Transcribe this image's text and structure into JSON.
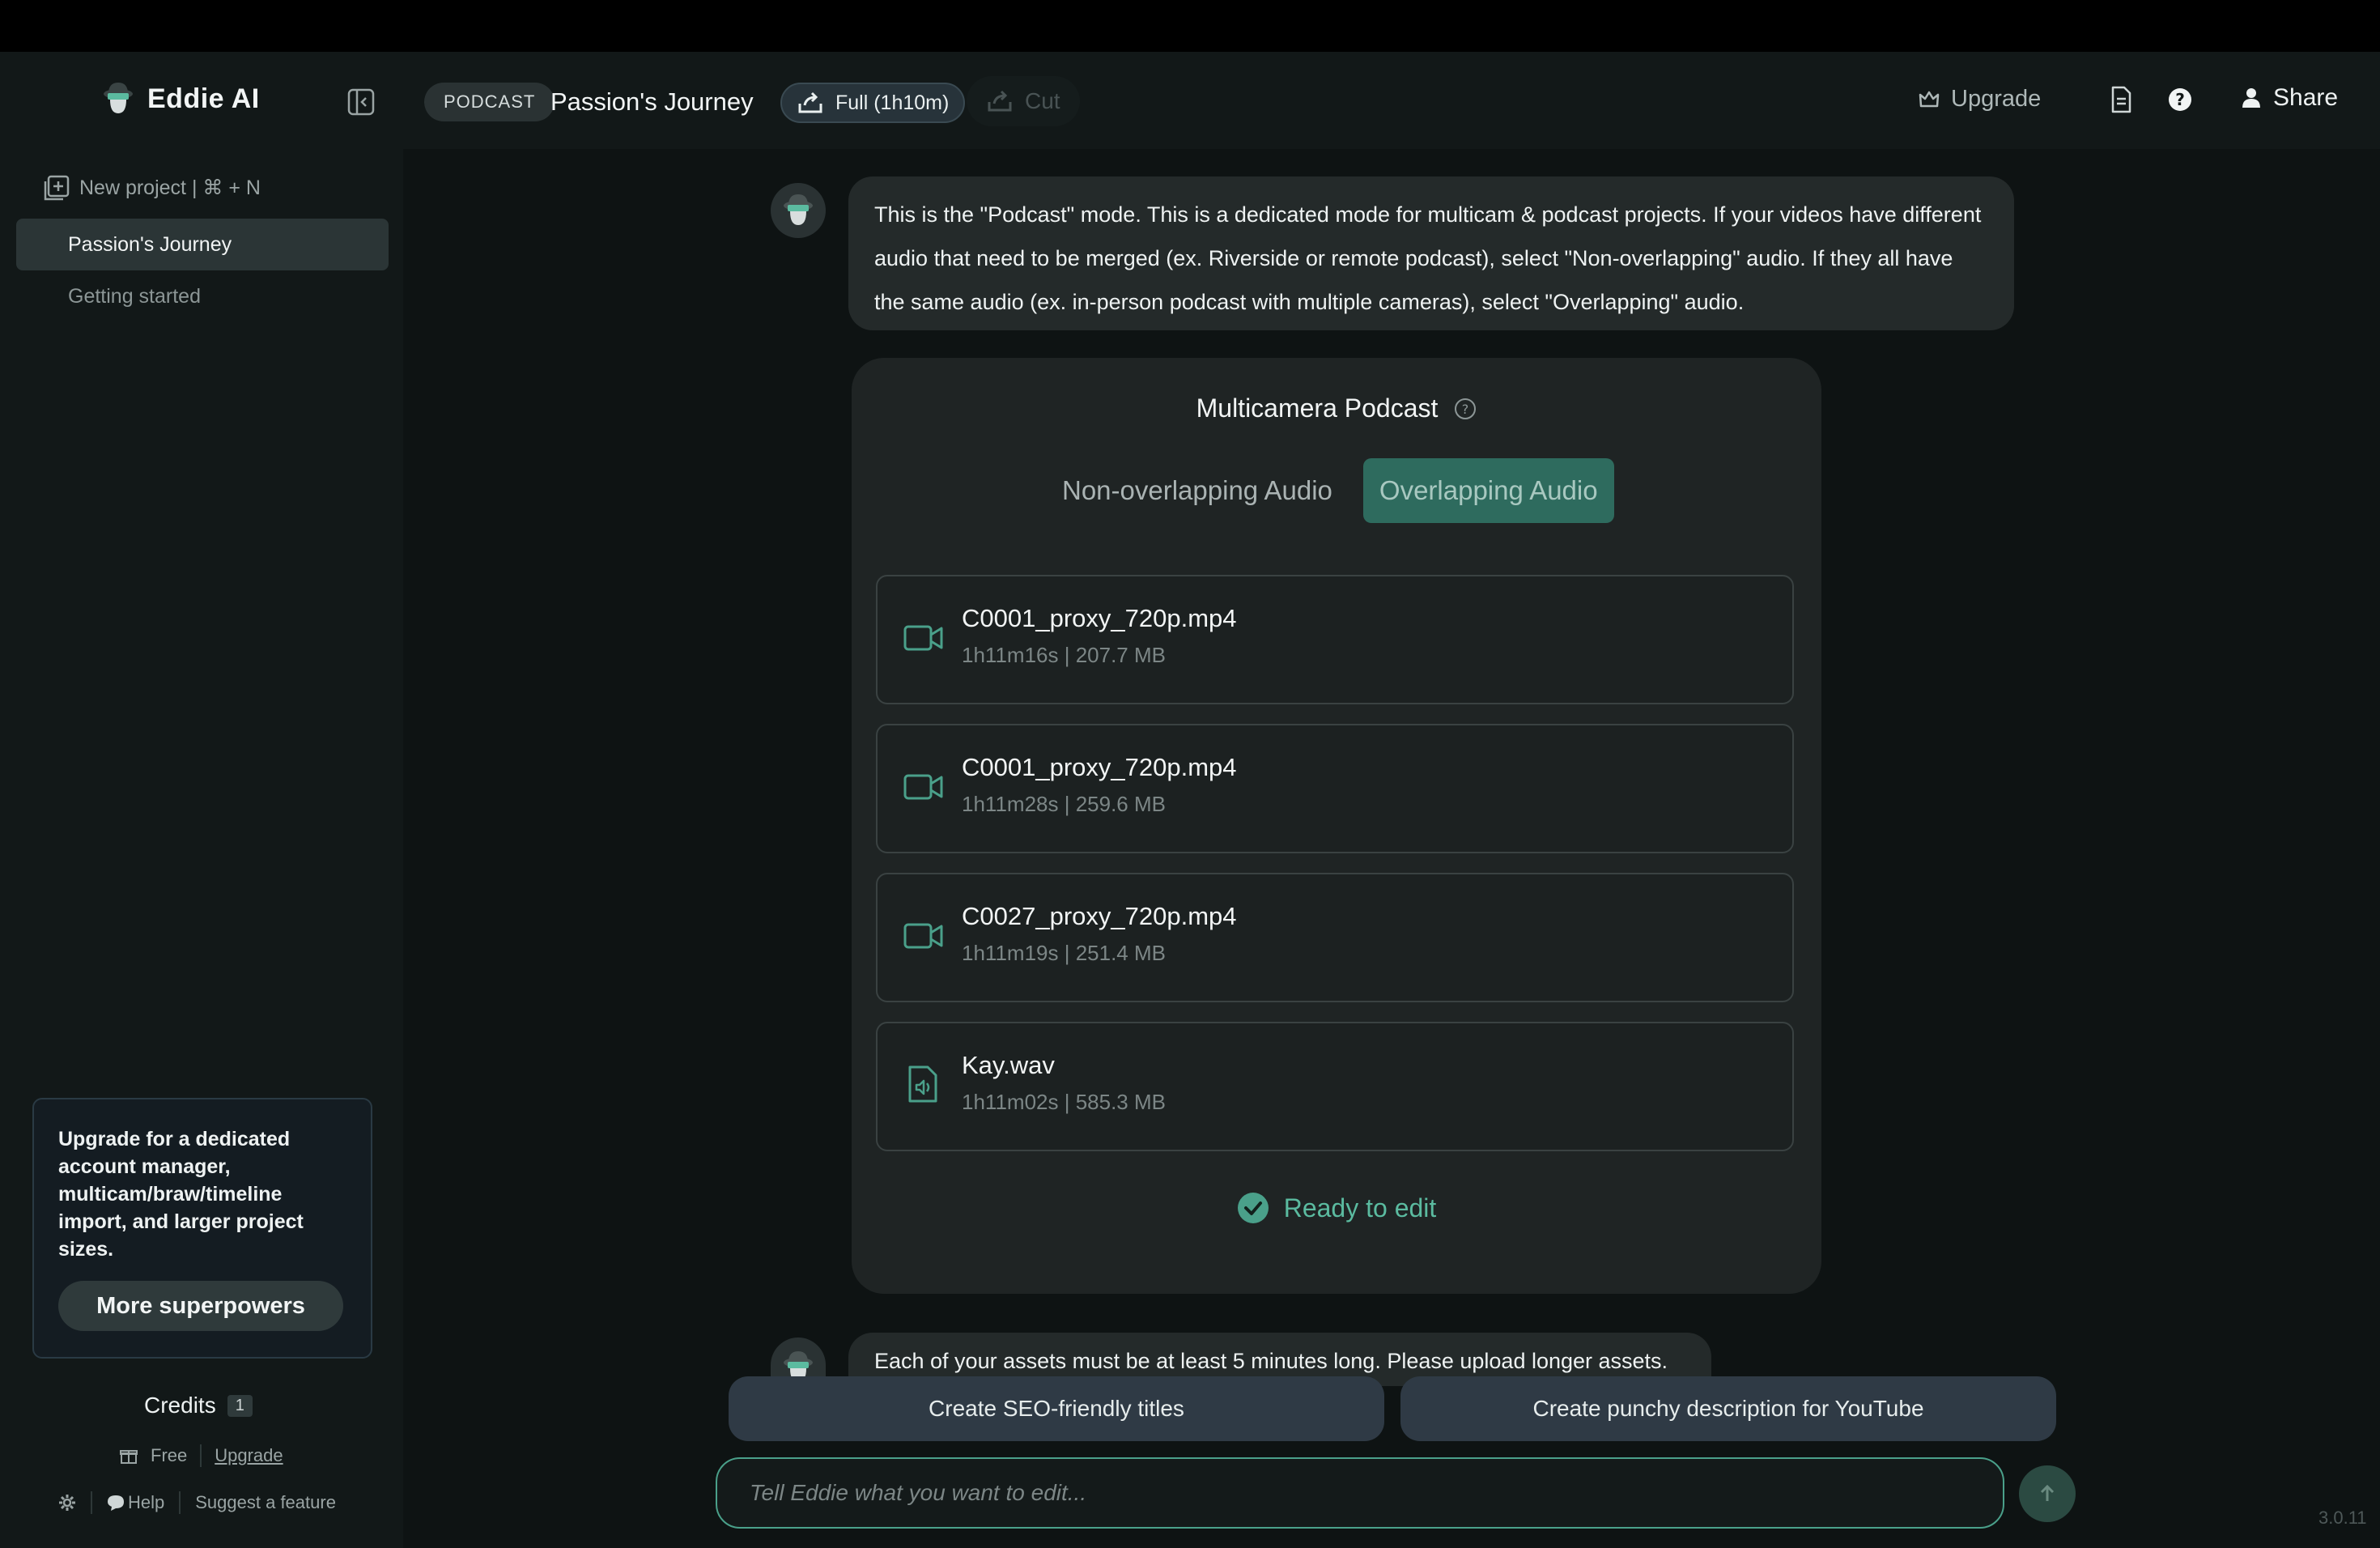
{
  "app": {
    "brand": "Eddie AI",
    "version": "3.0.11"
  },
  "header": {
    "mode_badge": "PODCAST",
    "project_title": "Passion's Journey",
    "full_label": "Full (1h10m)",
    "cut_label": "Cut",
    "upgrade_label": "Upgrade",
    "share_label": "Share"
  },
  "sidebar": {
    "new_project_label": "New project | ⌘ + N",
    "items": [
      {
        "label": "Passion's Journey",
        "active": true
      },
      {
        "label": "Getting started",
        "active": false
      }
    ],
    "promo": {
      "text": "Upgrade for a dedicated account manager, multicam/braw/timeline import, and larger project sizes.",
      "button": "More superpowers"
    },
    "credits_label": "Credits",
    "credits_count": "1",
    "plan_label": "Free",
    "plan_upgrade_label": "Upgrade",
    "help_label": "Help",
    "suggest_label": "Suggest a feature"
  },
  "chat": {
    "message1": "This is the \"Podcast\" mode. This is a dedicated mode for multicam & podcast projects. If your videos have different audio that need to be merged (ex. Riverside or remote podcast), select \"Non-overlapping\" audio. If they all have the same audio (ex. in-person podcast with multiple cameras), select \"Overlapping\" audio.",
    "card": {
      "title": "Multicamera Podcast",
      "options": [
        {
          "label": "Non-overlapping Audio",
          "selected": false
        },
        {
          "label": "Overlapping Audio",
          "selected": true
        }
      ],
      "files": [
        {
          "name": "C0001_proxy_720p.mp4",
          "meta": "1h11m16s | 207.7 MB",
          "type": "video"
        },
        {
          "name": "C0001_proxy_720p.mp4",
          "meta": "1h11m28s | 259.6 MB",
          "type": "video"
        },
        {
          "name": "C0027_proxy_720p.mp4",
          "meta": "1h11m19s | 251.4 MB",
          "type": "video"
        },
        {
          "name": "Kay.wav",
          "meta": "1h11m02s | 585.3 MB",
          "type": "audio"
        }
      ],
      "status": "Ready to edit"
    },
    "message2": "Each of your assets must be at least 5 minutes long. Please upload longer assets.",
    "suggestions": [
      "Create SEO-friendly titles",
      "Create punchy description for YouTube"
    ],
    "input_placeholder": "Tell Eddie what you want to edit..."
  },
  "colors": {
    "accent": "#2e6b5e",
    "ready": "#5bbba0",
    "background": "#0e1313"
  }
}
